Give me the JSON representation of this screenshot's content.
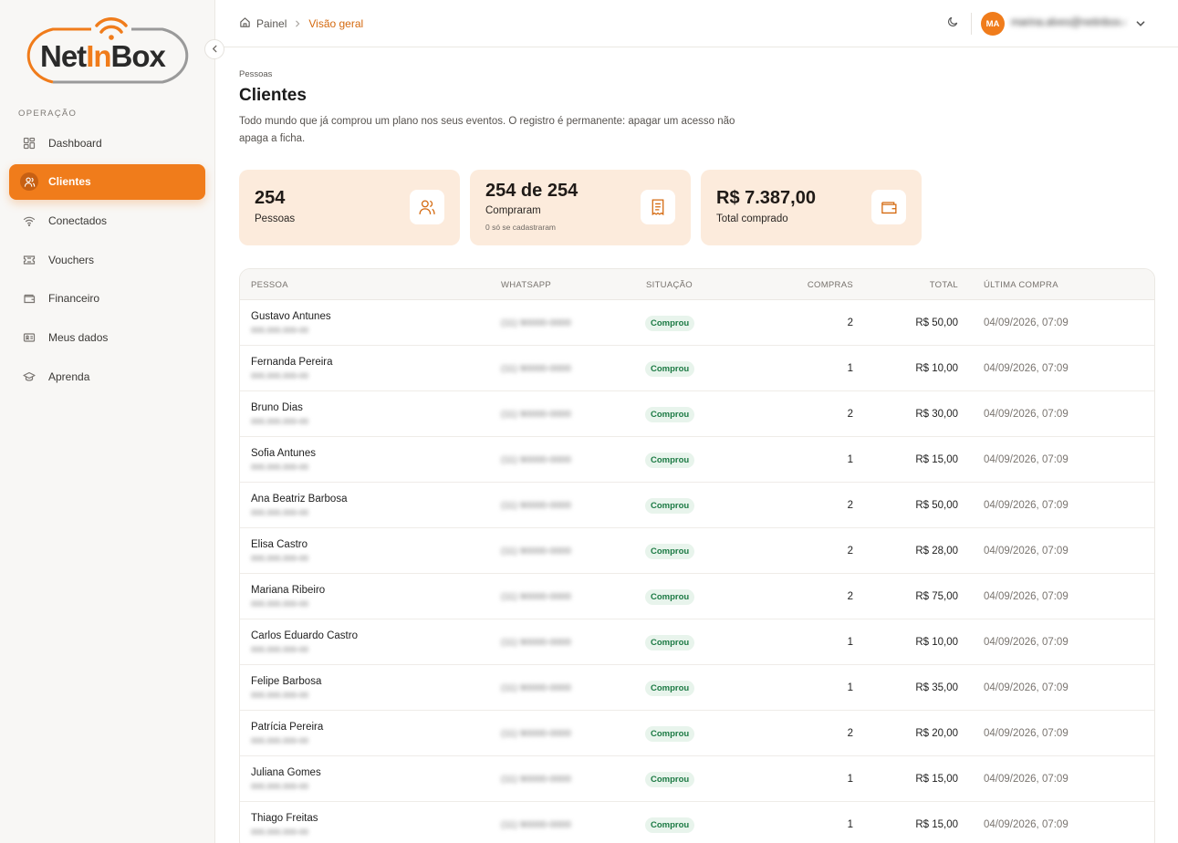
{
  "brand": {
    "logo_text_left": "Net",
    "logo_text_mid": "In",
    "logo_text_right": "Box",
    "accent": "#f07c1b"
  },
  "sidebar": {
    "section_label": "OPERAÇÃO",
    "items": [
      {
        "label": "Dashboard",
        "icon": "dashboard-icon"
      },
      {
        "label": "Clientes",
        "icon": "users-icon",
        "active": true
      },
      {
        "label": "Conectados",
        "icon": "wifi-icon"
      },
      {
        "label": "Vouchers",
        "icon": "ticket-icon"
      },
      {
        "label": "Financeiro",
        "icon": "wallet-icon"
      },
      {
        "label": "Meus dados",
        "icon": "id-card-icon"
      },
      {
        "label": "Aprenda",
        "icon": "graduation-cap-icon"
      }
    ]
  },
  "topbar": {
    "breadcrumb_home": "Painel",
    "breadcrumb_current": "Visão geral",
    "avatar_initials": "MA",
    "user_email": "marina.alves@netinbox.com"
  },
  "page": {
    "eyebrow": "Pessoas",
    "title": "Clientes",
    "description": "Todo mundo que já comprou um plano nos seus eventos. O registro é permanente: apagar um acesso não apaga a ficha."
  },
  "stats": [
    {
      "value": "254",
      "label": "Pessoas",
      "icon": "users-icon"
    },
    {
      "value": "254 de 254",
      "label": "Compraram",
      "note": "0 só se cadastraram",
      "icon": "receipt-icon"
    },
    {
      "value": "R$ 7.387,00",
      "label": "Total comprado",
      "icon": "wallet-icon"
    }
  ],
  "table": {
    "headers": {
      "person": "PESSOA",
      "whatsapp": "WHATSAPP",
      "status": "SITUAÇÃO",
      "purchases": "COMPRAS",
      "total": "TOTAL",
      "last_purchase": "ÚLTIMA COMPRA"
    },
    "rows": [
      {
        "name": "Gustavo Antunes",
        "id": "000.000.000-00",
        "whatsapp": "(11) 90000-0000",
        "status": "Comprou",
        "purchases": "2",
        "total": "R$ 50,00",
        "last": "04/09/2026, 07:09"
      },
      {
        "name": "Fernanda Pereira",
        "id": "000.000.000-00",
        "whatsapp": "(11) 90000-0000",
        "status": "Comprou",
        "purchases": "1",
        "total": "R$ 10,00",
        "last": "04/09/2026, 07:09"
      },
      {
        "name": "Bruno Dias",
        "id": "000.000.000-00",
        "whatsapp": "(11) 90000-0000",
        "status": "Comprou",
        "purchases": "2",
        "total": "R$ 30,00",
        "last": "04/09/2026, 07:09"
      },
      {
        "name": "Sofia Antunes",
        "id": "000.000.000-00",
        "whatsapp": "(11) 90000-0000",
        "status": "Comprou",
        "purchases": "1",
        "total": "R$ 15,00",
        "last": "04/09/2026, 07:09"
      },
      {
        "name": "Ana Beatriz Barbosa",
        "id": "000.000.000-00",
        "whatsapp": "(11) 90000-0000",
        "status": "Comprou",
        "purchases": "2",
        "total": "R$ 50,00",
        "last": "04/09/2026, 07:09"
      },
      {
        "name": "Elisa Castro",
        "id": "000.000.000-00",
        "whatsapp": "(11) 90000-0000",
        "status": "Comprou",
        "purchases": "2",
        "total": "R$ 28,00",
        "last": "04/09/2026, 07:09"
      },
      {
        "name": "Mariana Ribeiro",
        "id": "000.000.000-00",
        "whatsapp": "(11) 90000-0000",
        "status": "Comprou",
        "purchases": "2",
        "total": "R$ 75,00",
        "last": "04/09/2026, 07:09"
      },
      {
        "name": "Carlos Eduardo Castro",
        "id": "000.000.000-00",
        "whatsapp": "(11) 90000-0000",
        "status": "Comprou",
        "purchases": "1",
        "total": "R$ 10,00",
        "last": "04/09/2026, 07:09"
      },
      {
        "name": "Felipe Barbosa",
        "id": "000.000.000-00",
        "whatsapp": "(11) 90000-0000",
        "status": "Comprou",
        "purchases": "1",
        "total": "R$ 35,00",
        "last": "04/09/2026, 07:09"
      },
      {
        "name": "Patrícia Pereira",
        "id": "000.000.000-00",
        "whatsapp": "(11) 90000-0000",
        "status": "Comprou",
        "purchases": "2",
        "total": "R$ 20,00",
        "last": "04/09/2026, 07:09"
      },
      {
        "name": "Juliana Gomes",
        "id": "000.000.000-00",
        "whatsapp": "(11) 90000-0000",
        "status": "Comprou",
        "purchases": "1",
        "total": "R$ 15,00",
        "last": "04/09/2026, 07:09"
      },
      {
        "name": "Thiago Freitas",
        "id": "000.000.000-00",
        "whatsapp": "(11) 90000-0000",
        "status": "Comprou",
        "purchases": "1",
        "total": "R$ 15,00",
        "last": "04/09/2026, 07:09"
      }
    ]
  }
}
